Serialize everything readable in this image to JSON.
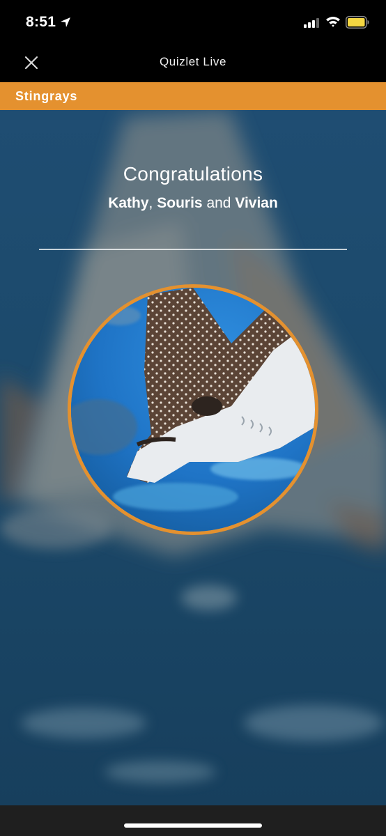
{
  "status_bar": {
    "time": "8:51",
    "icons": [
      "location-arrow-icon",
      "cellular-signal-icon",
      "wifi-icon",
      "battery-icon"
    ],
    "battery_color": "#f5d742"
  },
  "header": {
    "title": "Quizlet Live",
    "close_icon": "close-icon"
  },
  "team": {
    "name": "Stingrays",
    "color": "#e4912f"
  },
  "result": {
    "title": "Congratulations",
    "winners": [
      "Kathy",
      "Souris",
      "Vivian"
    ],
    "separator": ",",
    "conjunction": "and"
  },
  "avatar": {
    "subject": "stingray",
    "ring_color": "#e4912f"
  }
}
